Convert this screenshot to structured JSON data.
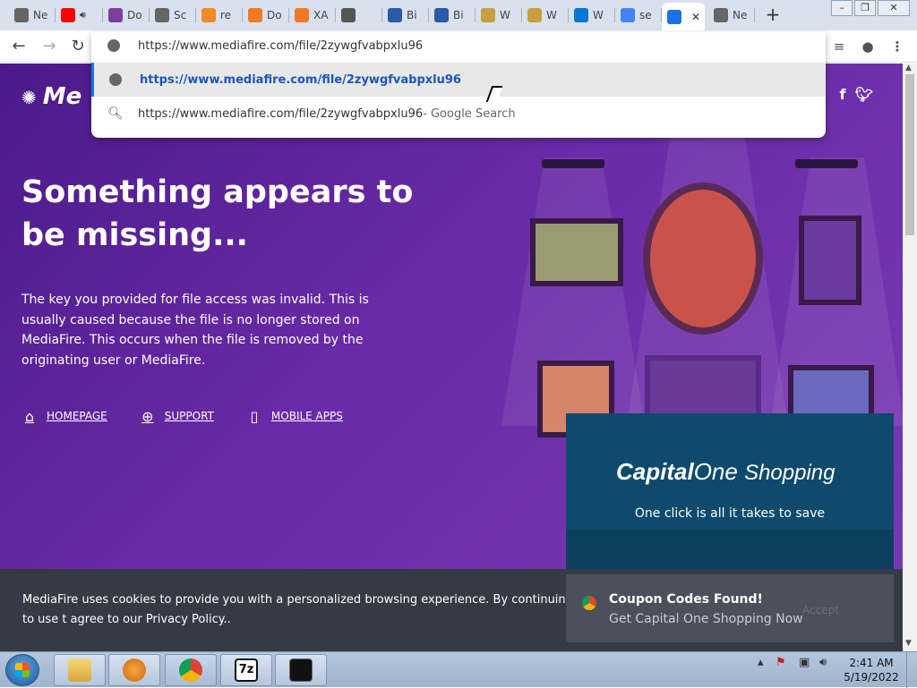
{
  "tabs": [
    {
      "label": "Ne",
      "icon": "globe-icon",
      "color": "#666666"
    },
    {
      "label": "",
      "icon": "youtube-icon",
      "color": "#ff0000"
    },
    {
      "label": "Do",
      "icon": "docs-icon",
      "color": "#7b3fa0"
    },
    {
      "label": "Sc",
      "icon": "globe-icon",
      "color": "#666666"
    },
    {
      "label": "re",
      "icon": "diamond-icon",
      "color": "#f08a24"
    },
    {
      "label": "Do",
      "icon": "orange-box-icon",
      "color": "#f07a24"
    },
    {
      "label": "XA",
      "icon": "orange-box-icon",
      "color": "#f07a24"
    },
    {
      "label": "",
      "icon": "checklist-icon",
      "color": "#555555"
    },
    {
      "label": "Bi",
      "icon": "hex-icon",
      "color": "#2a5aa8"
    },
    {
      "label": "Bi",
      "icon": "hex-icon",
      "color": "#2a5aa8"
    },
    {
      "label": "W",
      "icon": "book-icon",
      "color": "#c8a040"
    },
    {
      "label": "W",
      "icon": "book-icon",
      "color": "#c8a040"
    },
    {
      "label": "W",
      "icon": "windows-icon",
      "color": "#0078d4"
    },
    {
      "label": "se",
      "icon": "google-icon",
      "color": "#4285f4"
    },
    {
      "label": "",
      "icon": "mediafire-icon",
      "color": "#1a73e8"
    },
    {
      "label": "Ne",
      "icon": "globe-icon",
      "color": "#666666"
    }
  ],
  "omnibox": {
    "value": "https://www.mediafire.com/file/2zywgfvabpxlu96",
    "suggestions": [
      {
        "url": "https://www.mediafire.com/file/2zywgfvabpxlu96",
        "suffix": ""
      },
      {
        "url": "https://www.mediafire.com/file/2zywgfvabpxlu96",
        "suffix": " - Google Search"
      }
    ]
  },
  "page": {
    "logo": "Me",
    "title": "Something appears to be missing...",
    "description": "The key you provided for file access was invalid. This is usually caused because the file is no longer stored on MediaFire. This occurs when the file is removed by the originating user or MediaFire.",
    "links": [
      {
        "label": "HOMEPAGE",
        "icon": "home-icon"
      },
      {
        "label": "SUPPORT",
        "icon": "lifebuoy-icon"
      },
      {
        "label": "MOBILE APPS",
        "icon": "phone-icon"
      }
    ]
  },
  "cookie_text": "MediaFire uses cookies to provide you with a personalized browsing experience. By continuing to use t agree to our Privacy Policy..",
  "capital_one": {
    "brand_capital": "Capital",
    "brand_one": "One",
    "brand_shopping": "Shopping",
    "tagline": "One click is all it takes to save"
  },
  "coupon": {
    "heading": "Coupon Codes Found!",
    "sub": "Get Capital One Shopping Now",
    "accept": "Accept"
  },
  "clock": {
    "time": "2:41 AM",
    "date": "5/19/2022"
  }
}
